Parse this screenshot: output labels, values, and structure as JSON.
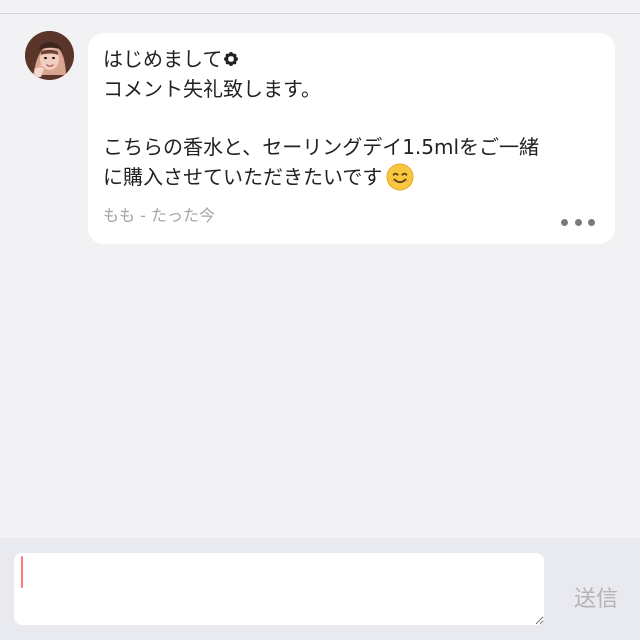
{
  "message": {
    "lines": [
      "はじめまして",
      "コメント失礼致します。",
      "こちらの香水と、セーリングデイ1.5mlをご一緒",
      "に購入させていただきたいです"
    ],
    "sender": "もも",
    "separator": " - ",
    "time": "たった今",
    "icons": {
      "inline_flower": "flower-icon",
      "inline_emoji": "smiling-face-icon",
      "menu": "more-options-icon",
      "avatar": "avatar"
    }
  },
  "composer": {
    "placeholder": "",
    "value": "",
    "send_label": "送信"
  },
  "colors": {
    "background": "#f2f2f4",
    "bubble": "#ffffff",
    "input_bar": "#e9eaef",
    "caret": "#ff7b7b",
    "send_disabled": "#b3b3b8",
    "meta_text": "#a3a3a8"
  }
}
